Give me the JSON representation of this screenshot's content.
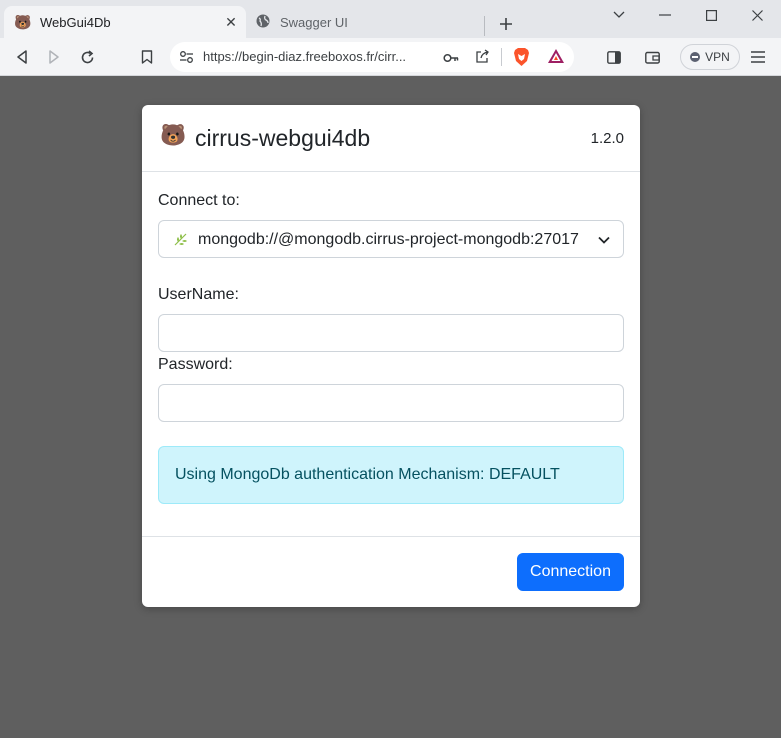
{
  "browser": {
    "tabs": [
      {
        "title": "WebGui4Db",
        "favicon": "bear-icon",
        "active": true
      },
      {
        "title": "Swagger UI",
        "favicon": "globe-icon",
        "active": false
      }
    ],
    "url": "https://begin-diaz.freeboxos.fr/cirr...",
    "vpn_label": "VPN",
    "colors": {
      "brave": "#fb542b",
      "bat": "#9e1f63"
    }
  },
  "modal": {
    "app_title": "cirrus-webgui4db",
    "version": "1.2.0",
    "connect_label": "Connect to:",
    "connection_value": "mongodb://@mongodb.cirrus-project-mongodb:27017",
    "username_label": "UserName:",
    "username_value": "",
    "password_label": "Password:",
    "password_value": "",
    "alert_text": "Using MongoDb authentication Mechanism: DEFAULT",
    "connect_button": "Connection",
    "colors": {
      "primary": "#0d6efd",
      "info_bg": "#cff4fc",
      "info_text": "#055160"
    }
  }
}
